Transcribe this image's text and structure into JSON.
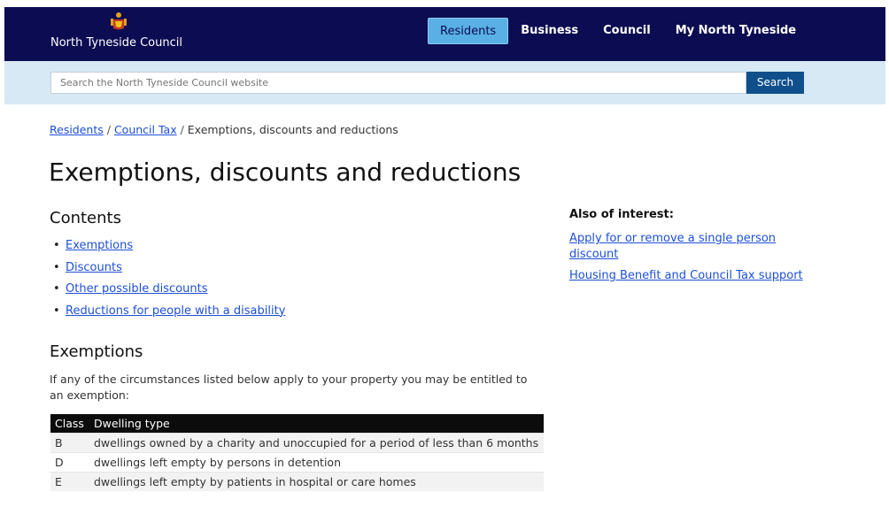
{
  "header": {
    "site_name": "North Tyneside Council",
    "nav": [
      {
        "label": "Residents",
        "active": true
      },
      {
        "label": "Business",
        "active": false
      },
      {
        "label": "Council",
        "active": false
      },
      {
        "label": "My North Tyneside",
        "active": false
      }
    ]
  },
  "search": {
    "placeholder": "Search the North Tyneside Council website",
    "button": "Search"
  },
  "breadcrumb": {
    "items": [
      "Residents",
      "Council Tax"
    ],
    "current": "Exemptions, discounts and reductions",
    "separator": "/"
  },
  "page_title": "Exemptions, discounts and reductions",
  "contents": {
    "heading": "Contents",
    "items": [
      "Exemptions",
      "Discounts",
      "Other possible discounts",
      "Reductions for people with a disability"
    ]
  },
  "aside": {
    "heading": "Also of interest:",
    "links": [
      "Apply for or remove a single person discount",
      "Housing Benefit and Council Tax support"
    ]
  },
  "exemptions": {
    "heading": "Exemptions",
    "intro": "If any of the circumstances listed below apply to your property you may be entitled to an exemption:",
    "table": {
      "headers": [
        "Class",
        "Dwelling type"
      ],
      "rows": [
        [
          "B",
          "dwellings owned by a charity and unoccupied for a period of less than 6 months"
        ],
        [
          "D",
          "dwellings left empty by persons in detention"
        ],
        [
          "E",
          "dwellings left empty by patients in hospital or care homes"
        ]
      ]
    }
  },
  "colors": {
    "header_bg": "#0c0c52",
    "nav_active_bg": "#59b0e4",
    "search_band_bg": "#d7e9f5",
    "search_button_bg": "#0f4f8b",
    "link": "#1d4fd9",
    "table_header_bg": "#0c0c0c"
  }
}
